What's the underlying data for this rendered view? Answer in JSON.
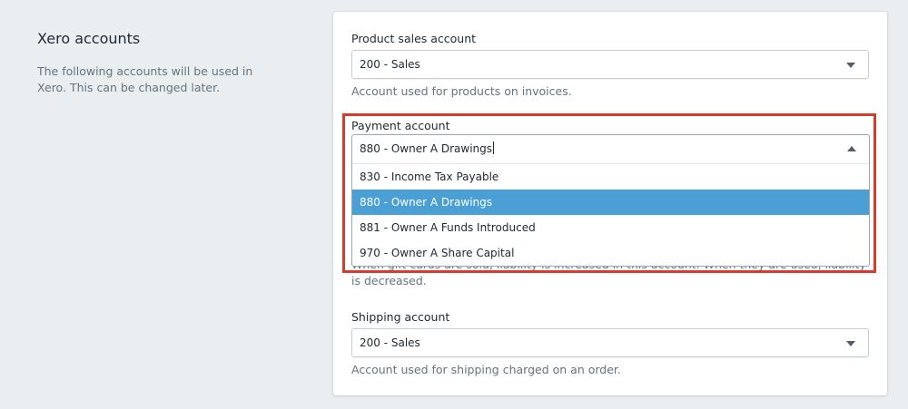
{
  "left": {
    "title": "Xero accounts",
    "description": "The following accounts will be used in Xero. This can be changed later."
  },
  "product_sales": {
    "label": "Product sales account",
    "value": "200 - Sales",
    "help": "Account used for products on invoices."
  },
  "payment": {
    "label": "Payment account",
    "value": "880 - Owner A Drawings",
    "options": [
      "830 - Income Tax Payable",
      "880 - Owner A Drawings",
      "881 - Owner A Funds Introduced",
      "970 - Owner A Share Capital"
    ],
    "selected_option": "880 - Owner A Drawings"
  },
  "gift_cards": {
    "help": "When gift cards are sold, liability is increased in this account. When they are used, liability is decreased."
  },
  "shipping": {
    "label": "Shipping account",
    "value": "200 - Sales",
    "help": "Account used for shipping charged on an order."
  },
  "colors": {
    "highlight_border": "#d93a2b",
    "selected_option_bg": "#4a9fd5"
  },
  "icons": {
    "select_caret": "caret-down-icon",
    "open_caret": "caret-up-icon"
  }
}
